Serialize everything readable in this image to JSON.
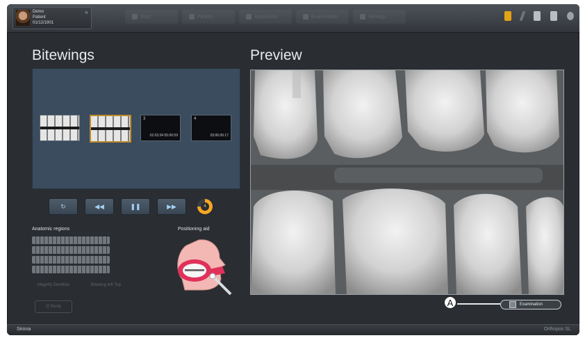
{
  "patient": {
    "line1": "Demo",
    "line2": "Patient",
    "line3": "01/12/1901"
  },
  "nav_tabs": [
    {
      "label": "Start",
      "icon": "folder-icon"
    },
    {
      "label": "Patient",
      "icon": "patient-icon"
    },
    {
      "label": "Acquisition",
      "icon": "acquire-icon"
    },
    {
      "label": "Examination",
      "icon": "exam-icon"
    },
    {
      "label": "Settings",
      "icon": "settings-icon"
    }
  ],
  "left": {
    "title": "Bitewings",
    "thumbnails": [
      {
        "type": "xray",
        "selected": false
      },
      {
        "type": "xray",
        "selected": true
      },
      {
        "type": "empty",
        "number": "3",
        "date": "02.03.04 05:06:59"
      },
      {
        "type": "empty",
        "number": "4",
        "date": "03:06:06:17"
      }
    ],
    "controls": {
      "progress": "4"
    },
    "anatomic_label": "Anatomic regions",
    "positioning_label": "Positioning aid",
    "option1": "Magnify Dentition",
    "option2": "Bitewing left Top",
    "ghost_button": "Q Study"
  },
  "right": {
    "title": "Preview",
    "callout": "A",
    "exam_button": "Examination"
  },
  "footer": {
    "logo": "Sirona",
    "status": "Orthopos SL"
  },
  "colors": {
    "accent": "#f5a623",
    "background": "#2a2d31",
    "panel": "#3a4c5e"
  }
}
